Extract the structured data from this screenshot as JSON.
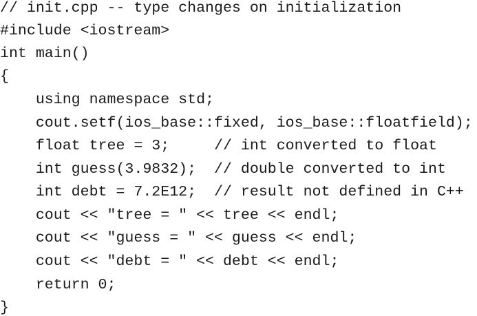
{
  "document": {
    "lines": [
      "// init.cpp -- type changes on initialization",
      "#include <iostream>",
      "int main()",
      "{",
      "    using namespace std;",
      "    cout.setf(ios_base::fixed, ios_base::floatfield);",
      "    float tree = 3;     // int converted to float",
      "    int guess(3.9832);  // double converted to int",
      "    int debt = 7.2E12;  // result not defined in C++",
      "    cout << \"tree = \" << tree << endl;",
      "    cout << \"guess = \" << guess << endl;",
      "    cout << \"debt = \" << debt << endl;",
      "    return 0;",
      "}"
    ]
  }
}
